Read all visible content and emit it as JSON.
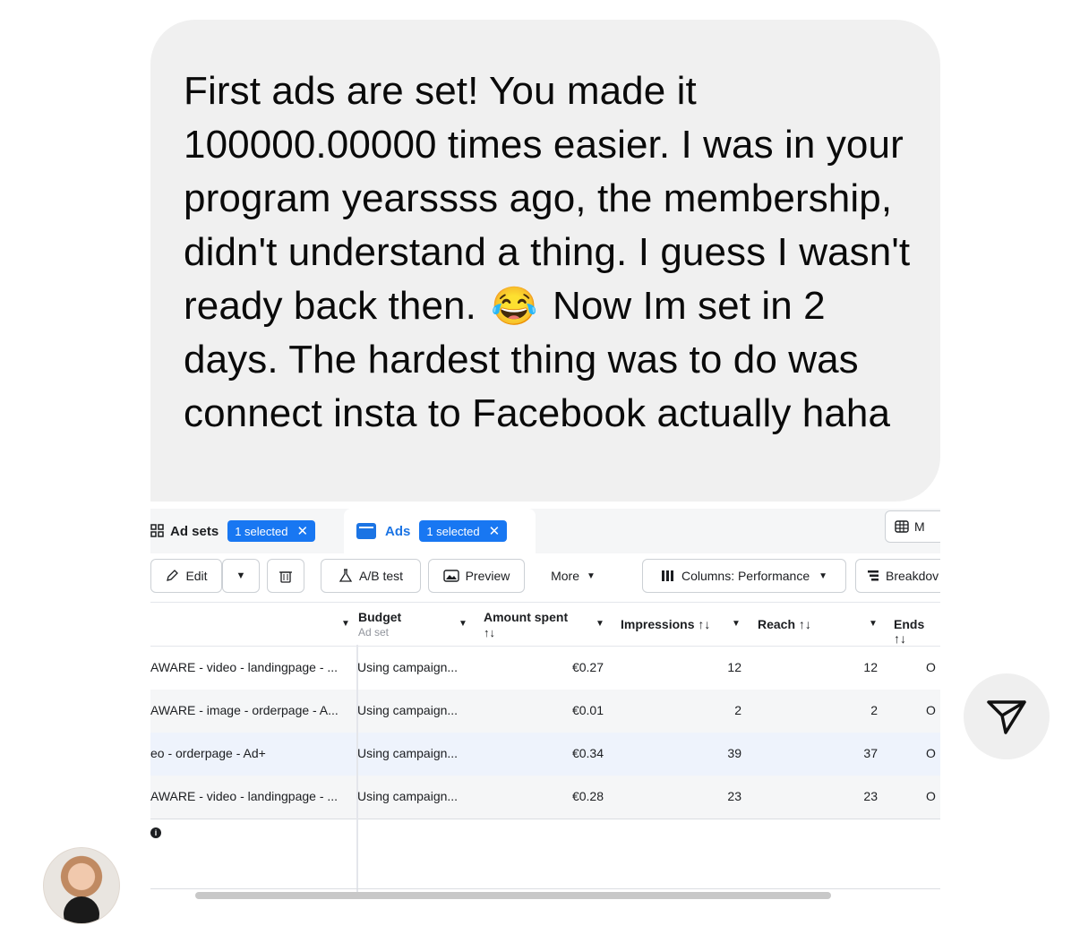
{
  "message": {
    "text_before_emoji": "First ads are set! You made it 100000.00000 times easier. I was in your program yearssss ago, the membership, didn't understand a thing. I guess I wasn't ready back then.",
    "emoji": "😂",
    "text_after_emoji": "Now Im set in 2 days. The hardest thing was to do was connect insta to Facebook actually haha"
  },
  "ads_manager": {
    "tabs": [
      {
        "label": "Ad sets",
        "badge": "1 selected",
        "icon": "ad-sets-grid-icon"
      },
      {
        "label": "Ads",
        "badge": "1 selected",
        "icon": "ads-icon"
      }
    ],
    "top_right_button": "M",
    "toolbar": {
      "edit": "Edit",
      "ab_test": "A/B test",
      "preview": "Preview",
      "more": "More",
      "columns": "Columns: Performance",
      "breakdown": "Breakdov"
    },
    "columns": {
      "budget": "Budget",
      "budget_sub": "Ad set",
      "amount_spent": "Amount spent",
      "amount_spent_sort": "↑↓",
      "impressions": "Impressions ↑↓",
      "reach": "Reach ↑↓",
      "ends": "Ends ↑↓"
    },
    "rows": [
      {
        "name": "AWARE - video - landingpage - ...",
        "budget": "Using campaign...",
        "spent": "€0.27",
        "impressions": "12",
        "reach": "12",
        "ends": "O"
      },
      {
        "name": "AWARE - image - orderpage - A...",
        "budget": "Using campaign...",
        "spent": "€0.01",
        "impressions": "2",
        "reach": "2",
        "ends": "O"
      },
      {
        "name": "eo - orderpage - Ad+",
        "budget": "Using campaign...",
        "spent": "€0.34",
        "impressions": "39",
        "reach": "37",
        "ends": "O"
      },
      {
        "name": "AWARE - video - landingpage - ...",
        "budget": "Using campaign...",
        "spent": "€0.28",
        "impressions": "23",
        "reach": "23",
        "ends": "O"
      }
    ]
  },
  "colors": {
    "bubble": "#f0f0f0",
    "accent": "#1877f2"
  }
}
